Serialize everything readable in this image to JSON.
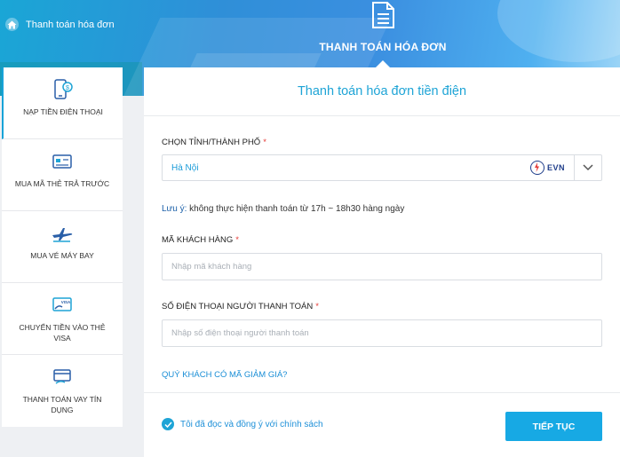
{
  "breadcrumb": {
    "label": "Thanh toán hóa đơn"
  },
  "service_tab": {
    "label": "THANH TOÁN HÓA ĐƠN"
  },
  "sidebar": {
    "items": [
      {
        "label": "NẠP TIỀN ĐIỆN THOẠI",
        "icon": "phone-topup-icon"
      },
      {
        "label": "MUA MÃ THẺ TRẢ TRƯỚC",
        "icon": "prepaid-card-icon"
      },
      {
        "label": "MUA VÉ MÁY BAY",
        "icon": "airplane-icon"
      },
      {
        "label": "CHUYỂN TIỀN VÀO THẺ VISA",
        "icon": "visa-card-icon"
      },
      {
        "label": "THANH TOÁN VAY TÍN DỤNG",
        "icon": "credit-loan-icon"
      }
    ]
  },
  "panel": {
    "title": "Thanh toán hóa đơn tiền điện",
    "province": {
      "label": "CHỌN TỈNH/THÀNH PHỐ",
      "required_mark": "*",
      "value": "Hà Nội",
      "provider": "EVN"
    },
    "note": {
      "key": "Lưu ý:",
      "text": " không thực hiện thanh toán từ 17h ~ 18h30 hàng ngày"
    },
    "customer_code": {
      "label": "MÃ KHÁCH HÀNG",
      "required_mark": "*",
      "placeholder": "Nhập mã khách hàng",
      "value": ""
    },
    "phone": {
      "label": "SỐ ĐIỆN THOẠI NGƯỜI THANH TOÁN",
      "required_mark": "*",
      "placeholder": "Nhập số điện thoại người thanh toán",
      "value": ""
    },
    "promo_link": "QUÝ KHÁCH CÓ MÃ GIẢM GIÁ?",
    "agree_text": "Tôi đã đọc và đồng ý với chính sách",
    "continue_label": "TIẾP TỤC"
  },
  "colors": {
    "accent": "#17a9e4",
    "link": "#1a8ed6",
    "required": "#e53935",
    "evn": "#1f3d8a"
  }
}
